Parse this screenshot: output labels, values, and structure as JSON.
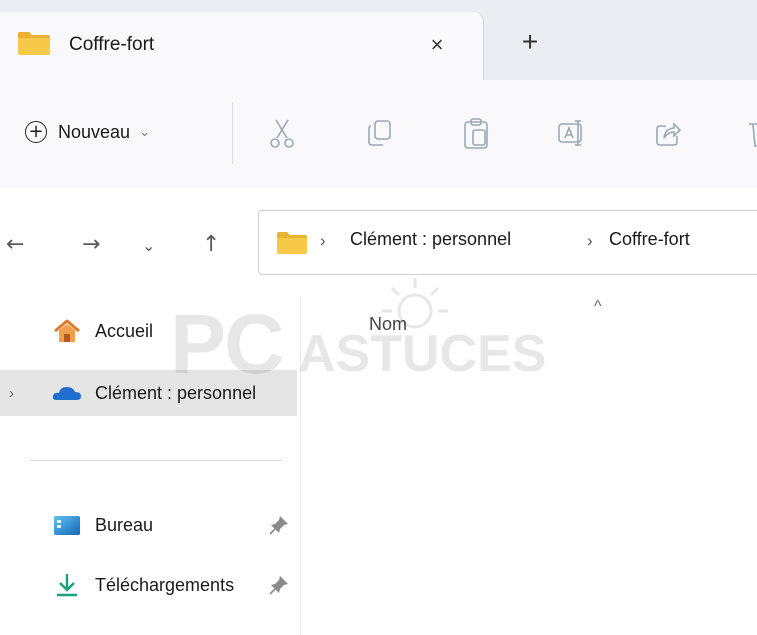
{
  "tab": {
    "title": "Coffre-fort",
    "close_glyph": "×",
    "new_tab_glyph": "+"
  },
  "toolbar": {
    "new_label": "Nouveau",
    "new_plus": "+",
    "new_caret": "⌄",
    "icons": [
      "cut-icon",
      "copy-icon",
      "paste-icon",
      "rename-icon",
      "share-icon",
      "delete-icon"
    ]
  },
  "nav": {
    "back": "←",
    "forward": "→",
    "recent": "⌄",
    "up": "↑"
  },
  "address": {
    "sep": "›",
    "crumbs": [
      "Clément : personnel",
      "Coffre-fort"
    ]
  },
  "sidebar": {
    "items": [
      {
        "label": "Accueil",
        "icon": "home-icon"
      },
      {
        "label": "Clément : personnel",
        "icon": "onedrive-cloud-icon",
        "expander": "›",
        "selected": true
      },
      {
        "label": "Bureau",
        "icon": "desktop-icon",
        "pinned": true
      },
      {
        "label": "Téléchargements",
        "icon": "download-icon",
        "pinned": true
      }
    ]
  },
  "content": {
    "column_name": "Nom",
    "sort_caret": "^"
  },
  "colors": {
    "folder": "#f7c948",
    "selected_bg": "#e5e5e5",
    "onedrive": "#1f6fd1",
    "download": "#1aa37a"
  }
}
